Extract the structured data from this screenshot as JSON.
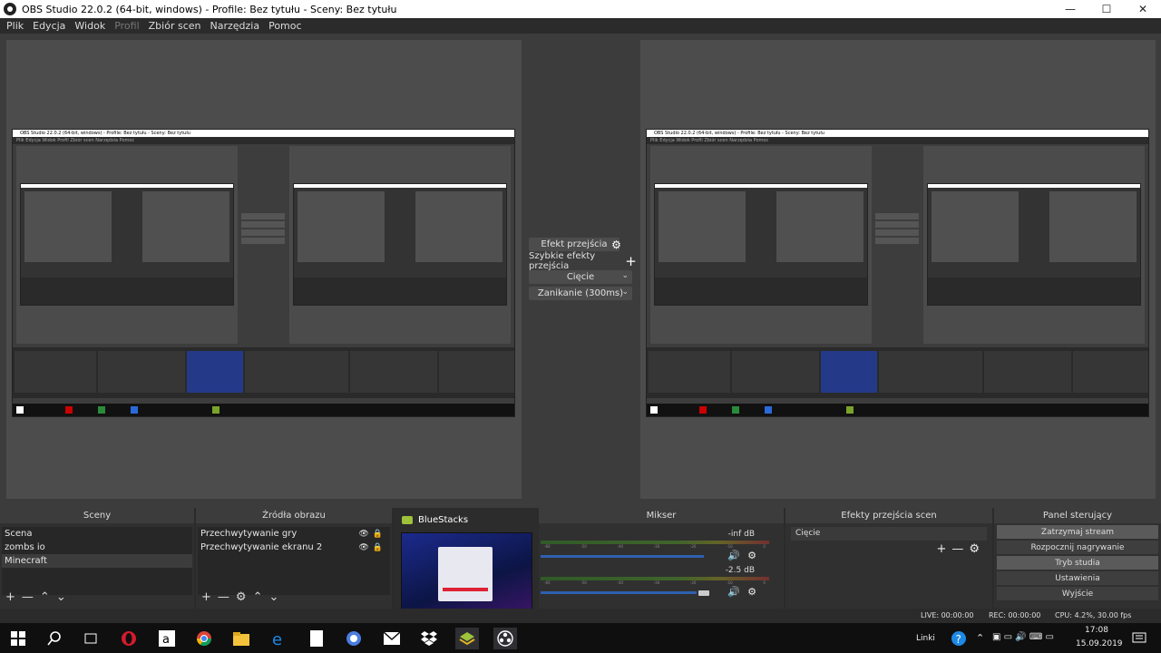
{
  "window": {
    "title": "OBS Studio 22.0.2 (64-bit, windows) - Profile: Bez tytułu - Sceny: Bez tytułu",
    "minimize": "—",
    "maximize": "☐",
    "close": "✕"
  },
  "menu": [
    "Plik",
    "Edycja",
    "Widok",
    "Profil",
    "Zbiór scen",
    "Narzędzia",
    "Pomoc"
  ],
  "transition_controls": {
    "effect_button": "Efekt przejścia",
    "quick_effects_label": "Szybkie efekty przejścia",
    "cut_button": "Cięcie",
    "fade_button": "Zanikanie (300ms)"
  },
  "nested_preview": {
    "title": "OBS Studio 22.0.2 (64-bit, windows) - Profile: Bez tytułu - Sceny: Bez tytułu",
    "menu": "Plik  Edycja  Widok  Profil  Zbiór scen  Narzędzia  Pomoc"
  },
  "scenes": {
    "header": "Sceny",
    "items": [
      "Scena",
      "zombs io",
      "Minecraft"
    ],
    "selected": 2
  },
  "sources": {
    "header": "Źródła obrazu",
    "items": [
      "Przechwytywanie gry",
      "Przechwytywanie ekranu 2"
    ]
  },
  "bluestacks_preview": {
    "title": "BlueStacks"
  },
  "mixer": {
    "header": "Mikser",
    "channels": [
      {
        "db": "-inf dB",
        "volume": 1.0
      },
      {
        "db": "-2.5 dB",
        "volume": 0.92
      }
    ]
  },
  "scene_transitions": {
    "header": "Efekty przejścia scen",
    "selected": "Cięcie"
  },
  "controls": {
    "header": "Panel sterujący",
    "buttons": [
      "Zatrzymaj stream",
      "Rozpocznij nagrywanie",
      "Tryb studia",
      "Ustawienia",
      "Wyjście"
    ]
  },
  "status": {
    "live": "LIVE: 00:00:00",
    "rec": "REC: 00:00:00",
    "cpu": "CPU: 4.2%, 30.00 fps"
  },
  "taskbar": {
    "links_label": "Linki",
    "time": "17:08",
    "date": "15.09.2019"
  },
  "colors": {
    "bg": "#3a3a3a",
    "dock": "#2b2b2b",
    "accent_blue": "#2f5fb0"
  }
}
